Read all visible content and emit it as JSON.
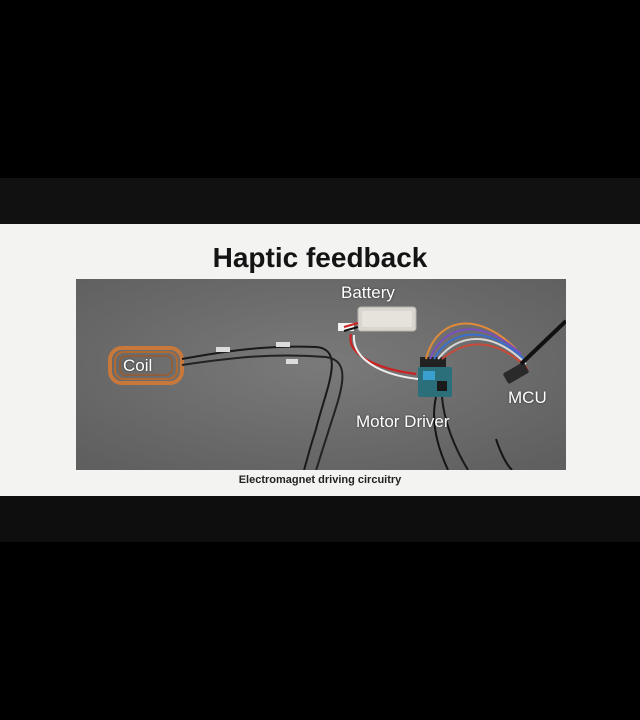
{
  "slide": {
    "title": "Haptic feedback",
    "caption": "Electromagnet driving circuitry",
    "labels": {
      "battery": "Battery",
      "coil": "Coil",
      "motor_driver": "Motor Driver",
      "mcu": "MCU"
    }
  }
}
